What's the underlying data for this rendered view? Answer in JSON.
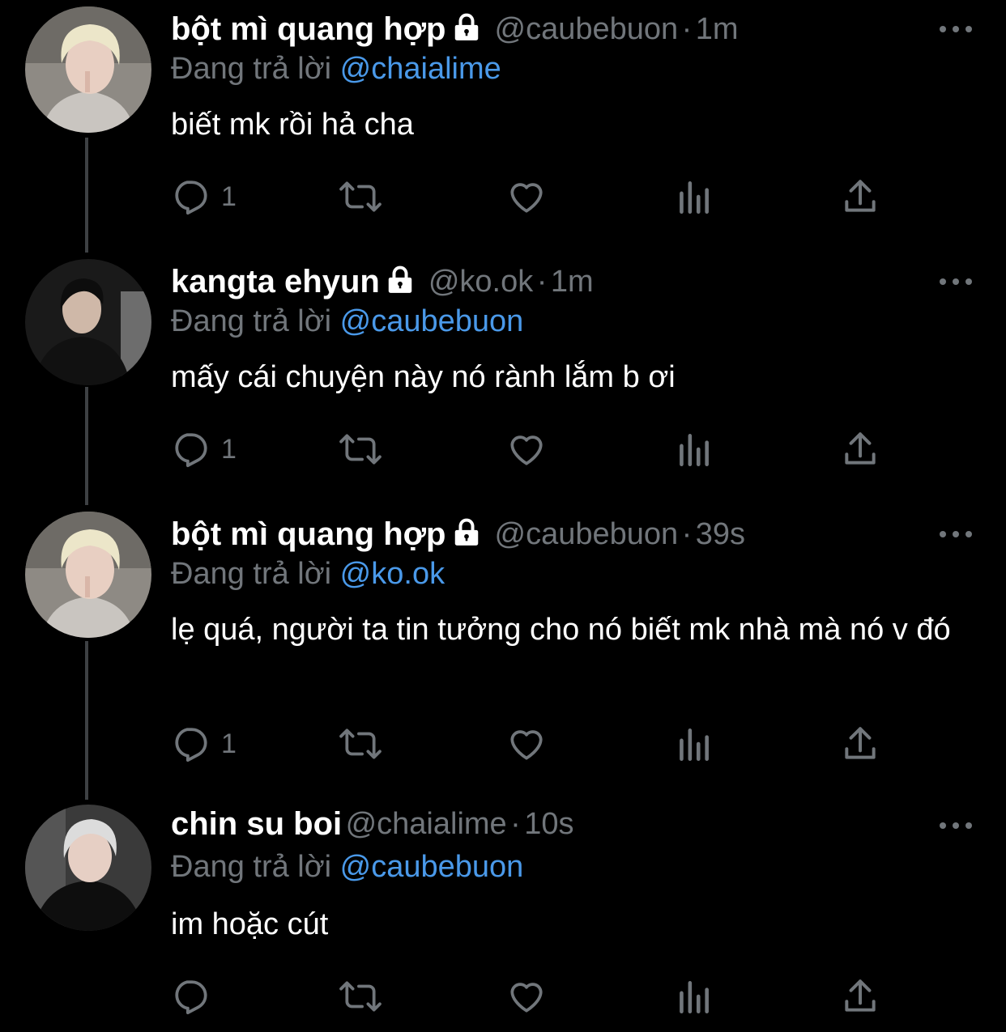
{
  "colors": {
    "background": "#000000",
    "muted": "#71767b",
    "link": "#4a99e9",
    "text": "#ffffff",
    "thread_line": "#3e4144"
  },
  "tweets": [
    {
      "name": "bột mì quang hợp",
      "locked": true,
      "handle": "@caubebuon",
      "separator": "·",
      "time": "1m",
      "replying_label": "Đang trả lời",
      "replying_to": "@chaialime",
      "text": "biết mk rồi hả cha",
      "reply_count": "1"
    },
    {
      "name": "kangta ehyun",
      "locked": true,
      "handle": "@ko.ok",
      "separator": "·",
      "time": "1m",
      "replying_label": "Đang trả lời",
      "replying_to": "@caubebuon",
      "text": "mấy cái chuyện này nó rành lắm b ơi",
      "reply_count": "1"
    },
    {
      "name": "bột mì quang hợp",
      "locked": true,
      "handle": "@caubebuon",
      "separator": "·",
      "time": "39s",
      "replying_label": "Đang trả lời",
      "replying_to": "@ko.ok",
      "text": "lẹ quá, người ta tin tưởng cho nó biết mk nhà mà nó v đó",
      "reply_count": "1"
    },
    {
      "name": "chin su boi",
      "locked": false,
      "handle": "@chaialime",
      "separator": "·",
      "time": "10s",
      "replying_label": "Đang trả lời",
      "replying_to": "@caubebuon",
      "text": "im hoặc cút",
      "reply_count": ""
    }
  ]
}
